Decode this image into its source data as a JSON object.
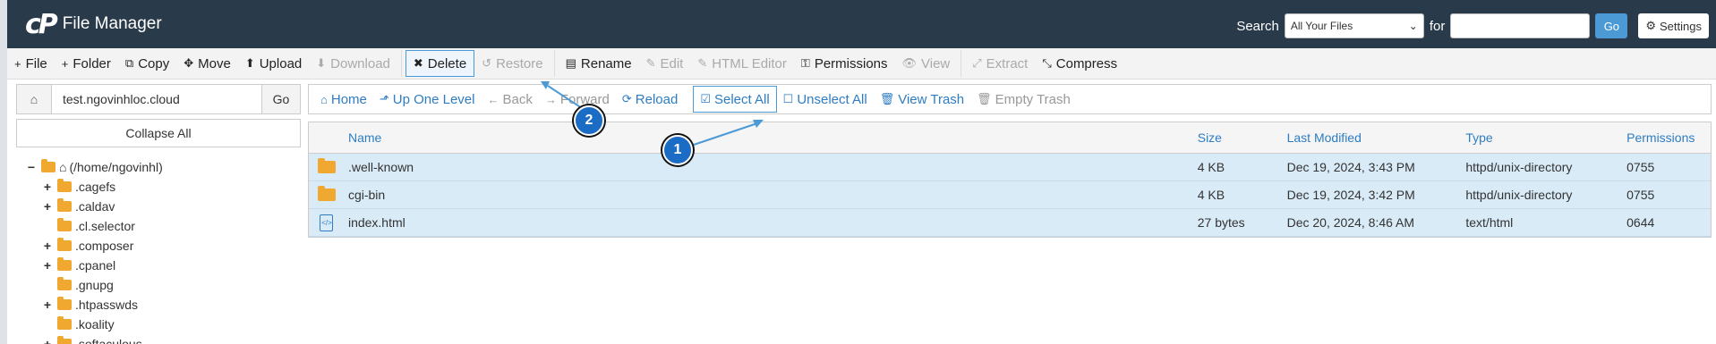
{
  "header": {
    "logo_mark": "cP",
    "title": "File Manager",
    "search_label": "Search",
    "search_scope": "All Your Files",
    "for_label": "for",
    "search_value": "",
    "go_label": "Go",
    "settings_label": "Settings"
  },
  "toolbar": [
    {
      "icon": "+",
      "label": "File",
      "name": "file-button",
      "enabled": true
    },
    {
      "icon": "+",
      "label": "Folder",
      "name": "folder-button",
      "enabled": true
    },
    {
      "icon": "⧉",
      "label": "Copy",
      "name": "copy-button",
      "enabled": true
    },
    {
      "icon": "✥",
      "label": "Move",
      "name": "move-button",
      "enabled": true
    },
    {
      "icon": "⬆",
      "label": "Upload",
      "name": "upload-button",
      "enabled": true
    },
    {
      "icon": "⬇",
      "label": "Download",
      "name": "download-button",
      "enabled": false
    },
    {
      "icon": "✖",
      "label": "Delete",
      "name": "delete-button",
      "enabled": true
    },
    {
      "icon": "↺",
      "label": "Restore",
      "name": "restore-button",
      "enabled": false
    },
    {
      "icon": "▤",
      "label": "Rename",
      "name": "rename-button",
      "enabled": true
    },
    {
      "icon": "✎",
      "label": "Edit",
      "name": "edit-button",
      "enabled": false
    },
    {
      "icon": "✎",
      "label": "HTML Editor",
      "name": "html-editor-button",
      "enabled": false
    },
    {
      "icon": "⚿",
      "label": "Permissions",
      "name": "permissions-button",
      "enabled": true
    },
    {
      "icon": "👁",
      "label": "View",
      "name": "view-button",
      "enabled": false
    },
    {
      "icon": "⤢",
      "label": "Extract",
      "name": "extract-button",
      "enabled": false
    },
    {
      "icon": "⤡",
      "label": "Compress",
      "name": "compress-button",
      "enabled": true
    }
  ],
  "sidebar": {
    "path_value": "test.ngovinhloc.cloud",
    "go_label": "Go",
    "collapse_label": "Collapse All",
    "root_label": "(/home/ngovinhl)",
    "root_toggle": "−",
    "items": [
      {
        "label": ".cagefs",
        "toggle": "+"
      },
      {
        "label": ".caldav",
        "toggle": "+"
      },
      {
        "label": ".cl.selector",
        "toggle": ""
      },
      {
        "label": ".composer",
        "toggle": "+"
      },
      {
        "label": ".cpanel",
        "toggle": "+"
      },
      {
        "label": ".gnupg",
        "toggle": ""
      },
      {
        "label": ".htpasswds",
        "toggle": "+"
      },
      {
        "label": ".koality",
        "toggle": ""
      },
      {
        "label": ".softaculous",
        "toggle": "+"
      }
    ]
  },
  "nav": [
    {
      "icon": "⌂",
      "label": "Home",
      "name": "home-nav-button",
      "enabled": true
    },
    {
      "icon": "⬏",
      "label": "Up One Level",
      "name": "up-one-level-button",
      "enabled": true
    },
    {
      "icon": "←",
      "label": "Back",
      "name": "back-button",
      "enabled": false
    },
    {
      "icon": "→",
      "label": "Forward",
      "name": "forward-button",
      "enabled": false
    },
    {
      "icon": "⟳",
      "label": "Reload",
      "name": "reload-button",
      "enabled": true
    },
    {
      "icon": "☑",
      "label": "Select All",
      "name": "select-all-button",
      "enabled": true
    },
    {
      "icon": "☐",
      "label": "Unselect All",
      "name": "unselect-all-button",
      "enabled": true
    },
    {
      "icon": "🗑",
      "label": "View Trash",
      "name": "view-trash-button",
      "enabled": true
    },
    {
      "icon": "🗑",
      "label": "Empty Trash",
      "name": "empty-trash-button",
      "enabled": false
    }
  ],
  "table": {
    "headers": {
      "name": "Name",
      "size": "Size",
      "modified": "Last Modified",
      "type": "Type",
      "perms": "Permissions"
    },
    "rows": [
      {
        "kind": "folder",
        "name": ".well-known",
        "size": "4 KB",
        "modified": "Dec 19, 2024, 3:43 PM",
        "type": "httpd/unix-directory",
        "perms": "0755"
      },
      {
        "kind": "folder",
        "name": "cgi-bin",
        "size": "4 KB",
        "modified": "Dec 19, 2024, 3:42 PM",
        "type": "httpd/unix-directory",
        "perms": "0755"
      },
      {
        "kind": "file",
        "name": "index.html",
        "size": "27 bytes",
        "modified": "Dec 20, 2024, 8:46 AM",
        "type": "text/html",
        "perms": "0644"
      }
    ]
  },
  "annotations": {
    "step1": "1",
    "step2": "2",
    "accent_color": "#4b9ad6"
  }
}
